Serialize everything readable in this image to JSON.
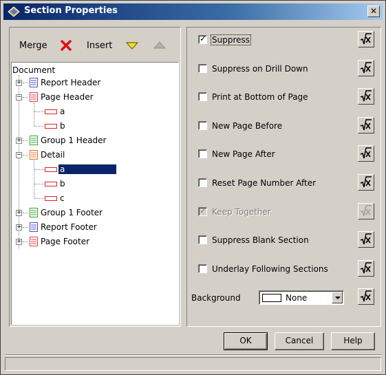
{
  "window": {
    "title": "Section Properties",
    "close_glyph": "✕",
    "icon": "section-properties-icon"
  },
  "toolbar": {
    "merge_label": "Merge",
    "delete_icon": "red-x-icon",
    "insert_label": "Insert",
    "move_down_icon": "triangle-down-icon",
    "move_up_icon": "triangle-up-icon"
  },
  "tree": {
    "root_label": "Document",
    "nodes": [
      {
        "label": "Report Header",
        "color": "#5050c0"
      },
      {
        "label": "Page Header",
        "color": "#e04040"
      },
      {
        "label": "a"
      },
      {
        "label": "b"
      },
      {
        "label": "Group 1 Header",
        "color": "#30a030"
      },
      {
        "label": "Detail",
        "color": "#e07020"
      },
      {
        "label": "a",
        "selected": true
      },
      {
        "label": "b"
      },
      {
        "label": "c"
      },
      {
        "label": "Group 1 Footer",
        "color": "#30a030"
      },
      {
        "label": "Report Footer",
        "color": "#5050c0"
      },
      {
        "label": "Page Footer",
        "color": "#e04040"
      }
    ]
  },
  "options": [
    {
      "label": "Suppress",
      "checked": true,
      "enabled": true
    },
    {
      "label": "Suppress on Drill Down",
      "checked": false,
      "enabled": true
    },
    {
      "label": "Print at Bottom of Page",
      "checked": false,
      "enabled": true
    },
    {
      "label": "New Page Before",
      "checked": false,
      "enabled": true
    },
    {
      "label": "New Page After",
      "checked": false,
      "enabled": true
    },
    {
      "label": "Reset Page Number After",
      "checked": false,
      "enabled": true
    },
    {
      "label": "Keep Together",
      "checked": true,
      "enabled": false
    },
    {
      "label": "Suppress Blank Section",
      "checked": false,
      "enabled": true
    },
    {
      "label": "Underlay Following Sections",
      "checked": false,
      "enabled": true
    }
  ],
  "background": {
    "label": "Background",
    "value": "None"
  },
  "buttons": {
    "ok": "OK",
    "cancel": "Cancel",
    "help": "Help"
  },
  "colors": {
    "title_start": "#0a246a",
    "title_end": "#a6caf0",
    "selection": "#0a246a",
    "face": "#d4d0c8"
  }
}
